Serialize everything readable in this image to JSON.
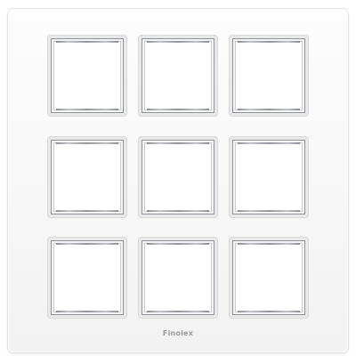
{
  "plate": {
    "brand": "Finolex",
    "rows": 3,
    "columns": 3,
    "color": "#f7f7f7",
    "module_count": 9
  }
}
